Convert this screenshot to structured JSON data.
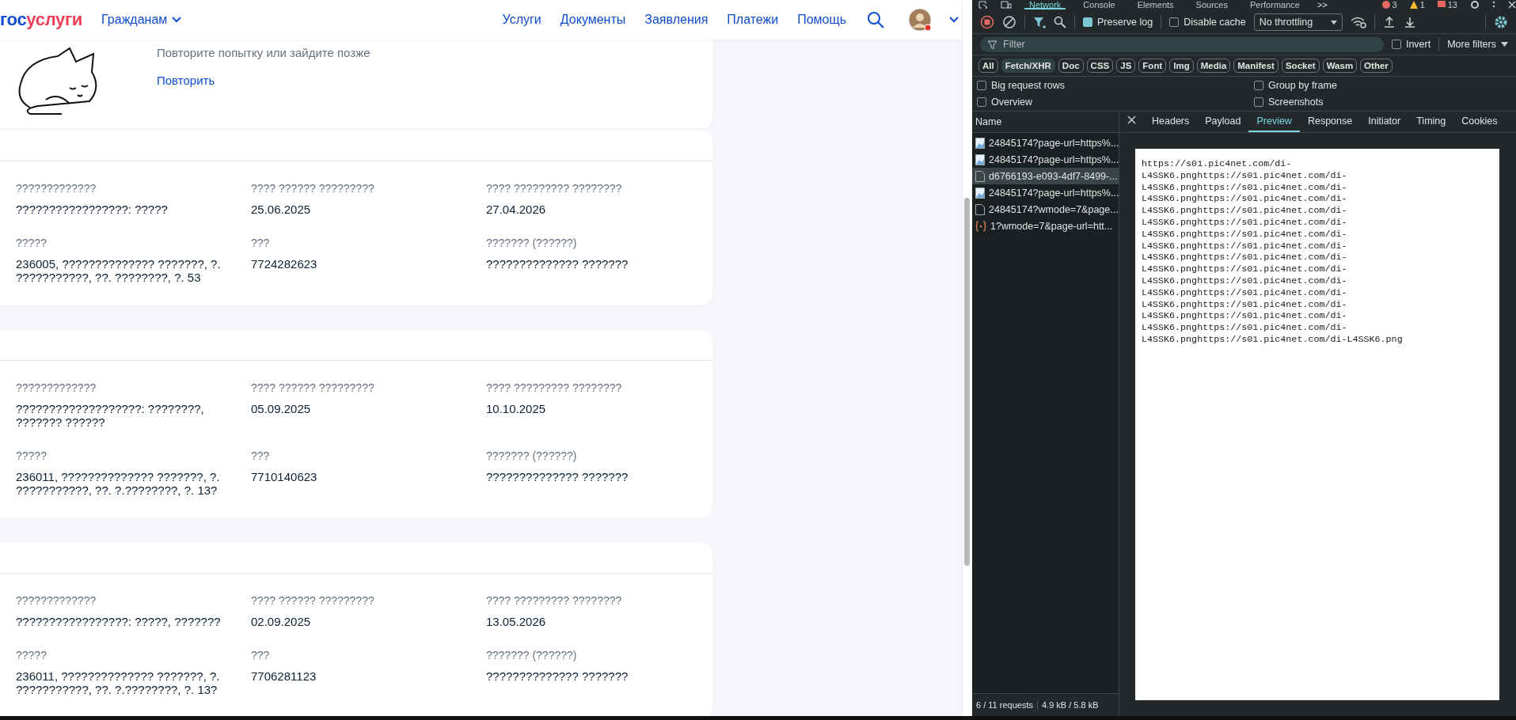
{
  "header": {
    "logo": [
      "гос",
      "услуги"
    ],
    "menu": "Гражданам",
    "nav": [
      "Услуги",
      "Документы",
      "Заявления",
      "Платежи",
      "Помощь"
    ]
  },
  "error_card": {
    "message": "Повторите попытку или зайдите позже",
    "retry": "Повторить"
  },
  "cards": [
    {
      "fields": [
        {
          "label": "?????????????",
          "value": "?????????????????: ?????"
        },
        {
          "label": "???? ?????? ?????????",
          "value": "25.06.2025"
        },
        {
          "label": "???? ????????? ????????",
          "value": "27.04.2026"
        },
        {
          "label": "?????",
          "value": "236005, ?????????????? ???????, ?. ???????????, ??. ????????, ?. 53"
        },
        {
          "label": "???",
          "value": "7724282623"
        },
        {
          "label": "??????? (??????)",
          "value": "?????????????? ???????"
        }
      ]
    },
    {
      "fields": [
        {
          "label": "?????????????",
          "value": "???????????????????: ????????, ??????? ??????"
        },
        {
          "label": "???? ?????? ?????????",
          "value": "05.09.2025"
        },
        {
          "label": "???? ????????? ????????",
          "value": "10.10.2025"
        },
        {
          "label": "?????",
          "value": "236011, ?????????????? ???????, ?. ???????????, ??. ?.????????, ?. 13?"
        },
        {
          "label": "???",
          "value": "7710140623"
        },
        {
          "label": "??????? (??????)",
          "value": "?????????????? ???????"
        }
      ]
    },
    {
      "fields": [
        {
          "label": "?????????????",
          "value": "?????????????????: ?????, ???????"
        },
        {
          "label": "???? ?????? ?????????",
          "value": "02.09.2025"
        },
        {
          "label": "???? ????????? ????????",
          "value": "13.05.2026"
        },
        {
          "label": "?????",
          "value": "236011, ?????????????? ???????, ?. ???????????, ??. ?.????????, ?. 13?"
        },
        {
          "label": "???",
          "value": "7706281123"
        },
        {
          "label": "??????? (??????)",
          "value": "?????????????? ???????"
        }
      ]
    }
  ],
  "devtools": {
    "panel_tabs": [
      {
        "label": "Network",
        "selected": true
      },
      {
        "label": "Console",
        "selected": false
      },
      {
        "label": "Elements",
        "selected": false
      },
      {
        "label": "Sources",
        "selected": false
      },
      {
        "label": "Performance",
        "selected": false
      }
    ],
    "more_tabs": ">>",
    "counts": {
      "errors": "3",
      "warnings": "1",
      "issues": "13"
    },
    "toolbar": {
      "recording": true,
      "preserve_log": {
        "label": "Preserve log",
        "checked": true
      },
      "disable_cache": {
        "label": "Disable cache",
        "checked": false
      },
      "throttling": "No throttling"
    },
    "filter": {
      "placeholder": "Filter",
      "invert": {
        "label": "Invert",
        "checked": false
      },
      "more_filters": "More filters"
    },
    "types": [
      {
        "label": "All",
        "selected": false
      },
      {
        "label": "Fetch/XHR",
        "selected": true
      },
      {
        "label": "Doc",
        "selected": false
      },
      {
        "label": "CSS",
        "selected": false
      },
      {
        "label": "JS",
        "selected": false
      },
      {
        "label": "Font",
        "selected": false
      },
      {
        "label": "Img",
        "selected": false
      },
      {
        "label": "Media",
        "selected": false
      },
      {
        "label": "Manifest",
        "selected": false
      },
      {
        "label": "Socket",
        "selected": false
      },
      {
        "label": "Wasm",
        "selected": false
      },
      {
        "label": "Other",
        "selected": false
      }
    ],
    "options": [
      {
        "label": "Big request rows",
        "checked": false
      },
      {
        "label": "Group by frame",
        "checked": false
      },
      {
        "label": "Overview",
        "checked": false
      },
      {
        "label": "Screenshots",
        "checked": false
      }
    ],
    "name_column": "Name",
    "requests": [
      {
        "name": "24845174?page-url=https%...",
        "kind": "image",
        "selected": false
      },
      {
        "name": "24845174?page-url=https%...",
        "kind": "image",
        "selected": false
      },
      {
        "name": "d6766193-e093-4df7-8499-...",
        "kind": "document",
        "selected": true
      },
      {
        "name": "24845174?page-url=https%...",
        "kind": "image",
        "selected": false
      },
      {
        "name": "24845174?wmode=7&page...",
        "kind": "document",
        "selected": false
      },
      {
        "name": "1?wmode=7&page-url=htt...",
        "kind": "script",
        "selected": false
      }
    ],
    "detail_tabs": [
      {
        "label": "Headers",
        "selected": false
      },
      {
        "label": "Payload",
        "selected": false
      },
      {
        "label": "Preview",
        "selected": true
      },
      {
        "label": "Response",
        "selected": false
      },
      {
        "label": "Initiator",
        "selected": false
      },
      {
        "label": "Timing",
        "selected": false
      },
      {
        "label": "Cookies",
        "selected": false
      }
    ],
    "preview_lines": [
      "https://s01.pic4net.com/di-",
      "L4SSK6.pnghttps://s01.pic4net.com/di-",
      "L4SSK6.pnghttps://s01.pic4net.com/di-",
      "L4SSK6.pnghttps://s01.pic4net.com/di-",
      "L4SSK6.pnghttps://s01.pic4net.com/di-",
      "L4SSK6.pnghttps://s01.pic4net.com/di-",
      "L4SSK6.pnghttps://s01.pic4net.com/di-",
      "L4SSK6.pnghttps://s01.pic4net.com/di-",
      "L4SSK6.pnghttps://s01.pic4net.com/di-",
      "L4SSK6.pnghttps://s01.pic4net.com/di-",
      "L4SSK6.pnghttps://s01.pic4net.com/di-",
      "L4SSK6.pnghttps://s01.pic4net.com/di-",
      "L4SSK6.pnghttps://s01.pic4net.com/di-",
      "L4SSK6.pnghttps://s01.pic4net.com/di-",
      "L4SSK6.pnghttps://s01.pic4net.com/di-",
      "L4SSK6.pnghttps://s01.pic4net.com/di-L4SSK6.png"
    ],
    "status": {
      "requests": "6 / 11 requests",
      "transferred": "4.9 kB / 5.8 kB"
    }
  }
}
